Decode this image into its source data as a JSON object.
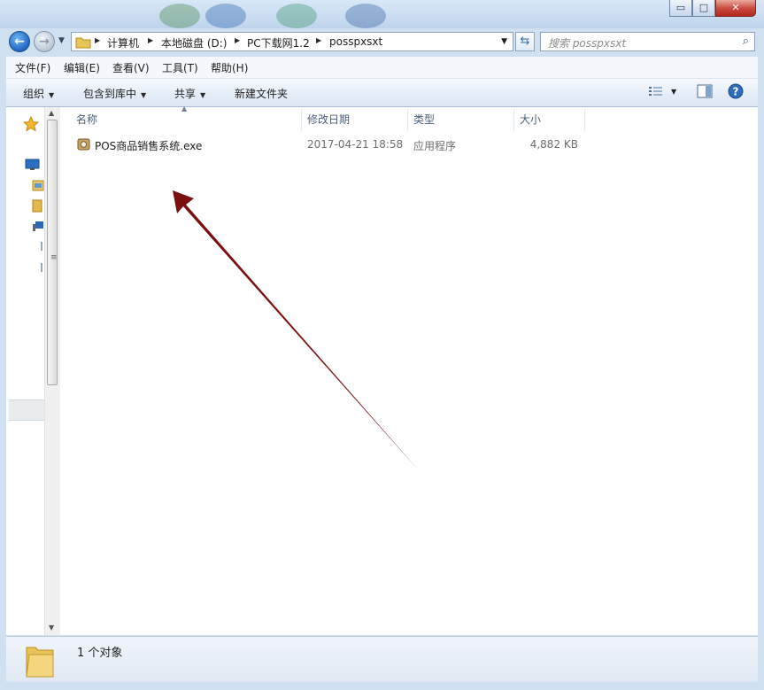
{
  "window": {
    "minimize_glyph": "▭",
    "maximize_glyph": "□",
    "close_glyph": "✕"
  },
  "addressbar": {
    "crumbs": [
      "计算机",
      "本地磁盘 (D:)",
      "PC下载网1.2",
      "posspxsxt"
    ]
  },
  "search": {
    "placeholder": "搜索 posspxsxt"
  },
  "menu": {
    "items": [
      "文件(F)",
      "编辑(E)",
      "查看(V)",
      "工具(T)",
      "帮助(H)"
    ]
  },
  "toolbar": {
    "organize": "组织",
    "include_library": "包含到库中",
    "share": "共享",
    "new_folder": "新建文件夹"
  },
  "columns": {
    "name": "名称",
    "modified": "修改日期",
    "type": "类型",
    "size": "大小"
  },
  "files": [
    {
      "name": "POS商品销售系统.exe",
      "modified": "2017-04-21 18:58",
      "type": "应用程序",
      "size": "4,882 KB"
    }
  ],
  "status": {
    "count_text": "1 个对象"
  },
  "colors": {
    "frame": "#cfe0f1",
    "arrow": "#7a0f0f",
    "header_text": "#4c607a"
  },
  "icons": [
    "back-arrow-icon",
    "forward-arrow-icon",
    "folder-icon",
    "refresh-icon",
    "search-icon",
    "view-options-icon",
    "preview-pane-icon",
    "help-icon",
    "favorites-star-icon",
    "desktop-icon",
    "library-icon",
    "application-icon",
    "annotation-arrow"
  ]
}
